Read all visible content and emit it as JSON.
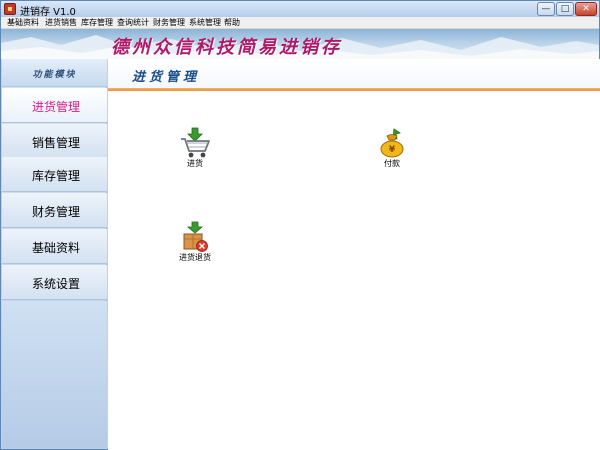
{
  "window": {
    "title": "进销存  V1.0",
    "minimize_glyph": "—",
    "maximize_glyph": "□",
    "close_glyph": "✕"
  },
  "menu": {
    "items": [
      "基础资料",
      "进货销售",
      "库存管理",
      "查询统计",
      "财务管理",
      "系统管理",
      "帮助"
    ]
  },
  "banner": {
    "title": "德州众信科技简易进销存"
  },
  "sidebar": {
    "header": "功能模块",
    "items": [
      {
        "label": "进货管理",
        "active": true
      },
      {
        "label": "销售管理",
        "active": false
      },
      {
        "label": "库存管理",
        "active": false
      },
      {
        "label": "财务管理",
        "active": false
      },
      {
        "label": "基础资料",
        "active": false
      },
      {
        "label": "系统设置",
        "active": false
      }
    ]
  },
  "main": {
    "title": "进货管理",
    "tiles": [
      {
        "label": "进货",
        "icon": "shopping-cart-icon"
      },
      {
        "label": "付款",
        "icon": "money-bag-icon"
      },
      {
        "label": "进货退货",
        "icon": "return-goods-icon"
      }
    ]
  },
  "colors": {
    "active_nav": "#d81b8c",
    "banner_title": "#b0186a",
    "page_title": "#1b4d8c",
    "accent_rule": "#e69138"
  }
}
